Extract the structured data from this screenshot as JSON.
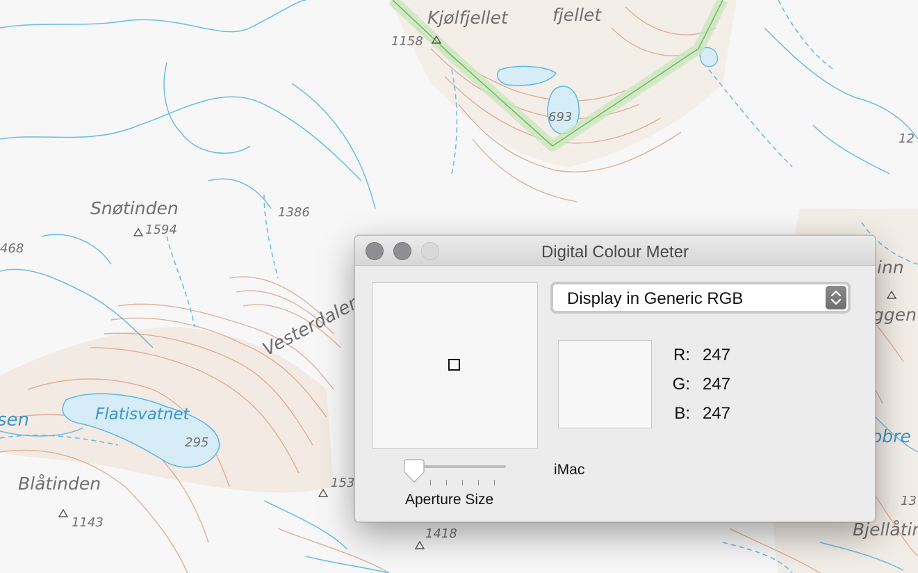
{
  "map": {
    "labels": {
      "kjolfjellet": "Kjølfjellet",
      "fjellet": "fjellet",
      "h1158": "1158",
      "h693": "693",
      "snotinden": "Snøtinden",
      "h1594": "1594",
      "h1386": "1386",
      "h468": "468",
      "vesterdalen": "Vesterdalen",
      "flatisvatnet": "Flatisvatnet",
      "h295": "295",
      "blatinden": "Blåtinden",
      "h1143": "1143",
      "h153": "153",
      "h1418": "1418",
      "bjellatind": "Bjellåtin",
      "inn": "inn",
      "ggen": "ggen",
      "obre": "obre",
      "h12": "12",
      "h13": "13",
      "sen": "sen"
    }
  },
  "window": {
    "title": "Digital Colour Meter",
    "display_mode": "Display in Generic RGB",
    "sample_color": "#f7f7f7",
    "channels": [
      {
        "label": "R:",
        "value": "247"
      },
      {
        "label": "G:",
        "value": "247"
      },
      {
        "label": "B:",
        "value": "247"
      }
    ],
    "aperture": {
      "label": "Aperture Size",
      "level": 0
    },
    "display_name": "iMac"
  },
  "colors": {
    "water": "#52b2e0",
    "contour": "#d7a385",
    "route": "#7cc86b"
  }
}
